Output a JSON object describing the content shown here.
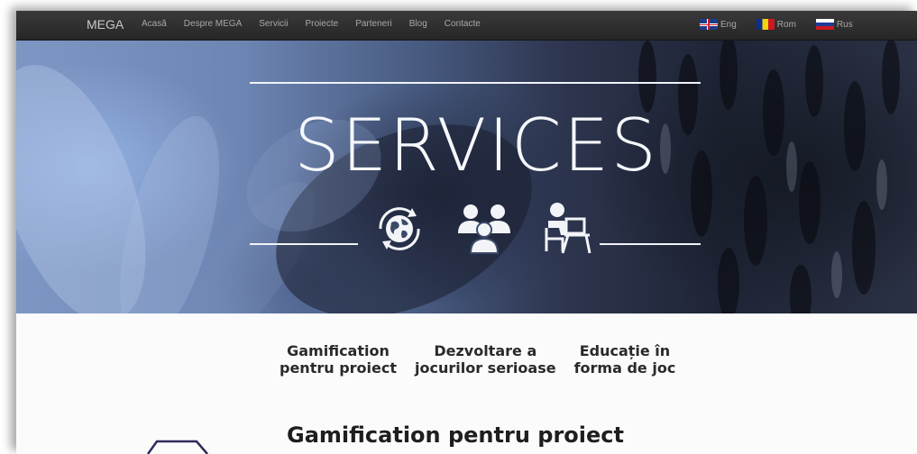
{
  "navbar": {
    "brand": "MEGA",
    "links": [
      "Acasă",
      "Despre MEGA",
      "Servicii",
      "Proiecte",
      "Parteneri",
      "Blog",
      "Contacte"
    ],
    "languages": [
      {
        "label": "Eng",
        "flag": "uk-flag-icon"
      },
      {
        "label": "Rom",
        "flag": "romania-flag-icon"
      },
      {
        "label": "Rus",
        "flag": "russia-flag-icon"
      }
    ]
  },
  "hero": {
    "title": "SERVICES",
    "icons": [
      "globe-refresh-icon",
      "group-people-icon",
      "person-at-desk-icon"
    ]
  },
  "tabs": [
    {
      "line1": "Gamification",
      "line2": "pentru proiect"
    },
    {
      "line1": "Dezvoltare a",
      "line2": "jocurilor serioase"
    },
    {
      "line1": "Educație în",
      "line2": "forma de joc"
    }
  ],
  "section": {
    "title": "Gamification pentru proiect"
  },
  "colors": {
    "navbar": "#2e2e2e",
    "hero_tint": "#6d85b3",
    "text_dark": "#1e1e1e"
  }
}
